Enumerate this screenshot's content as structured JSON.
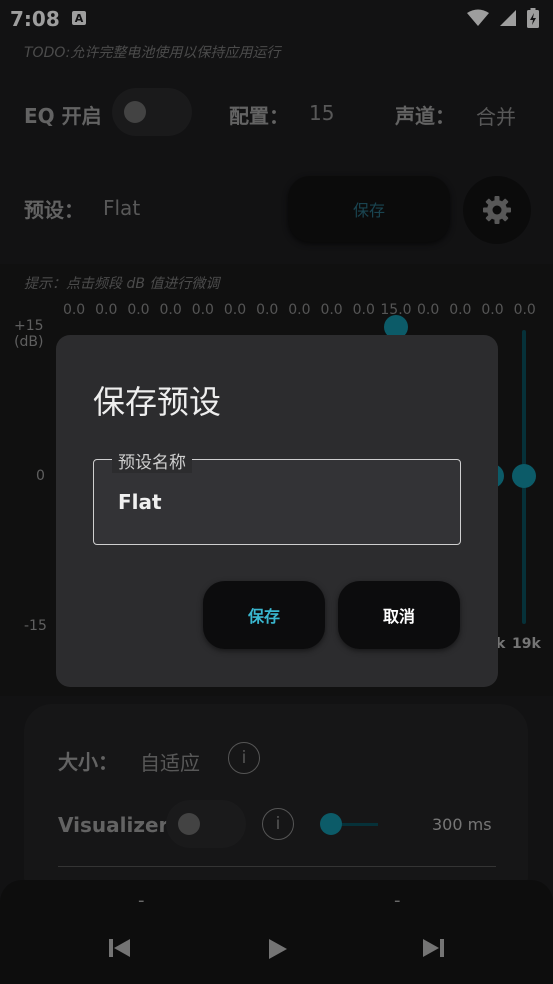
{
  "status": {
    "time": "7:08",
    "a_icon": "A"
  },
  "todo": "TODO:允许完整电池使用以保持应用运行",
  "eq": {
    "label": "EQ 开启",
    "config_label": "配置：",
    "config_value": "15",
    "channel_label": "声道：",
    "channel_value": "合并"
  },
  "preset": {
    "label": "预设：",
    "value": "Flat",
    "save_label": "保存"
  },
  "hint": "提示：点击频段 dB 值进行微调",
  "bands": {
    "values": [
      "0.0",
      "0.0",
      "0.0",
      "0.0",
      "0.0",
      "0.0",
      "0.0",
      "0.0",
      "0.0",
      "0.0",
      "15.0",
      "0.0",
      "0.0",
      "0.0",
      "0.0"
    ],
    "scale_top": "+15",
    "scale_top_unit": "(dB)",
    "scale_mid": "0",
    "scale_bottom": "-15",
    "freq_k": "k",
    "freq_19k": "19k"
  },
  "dialog": {
    "title": "保存预设",
    "field_label": "预设名称",
    "field_value": "Flat",
    "save_label": "保存",
    "cancel_label": "取消"
  },
  "card": {
    "size_label": "大小：",
    "size_value": "自适应",
    "visualizer_label": "Visualizer",
    "visualizer_ms": "300 ms",
    "info_glyph": "i"
  },
  "player": {
    "left_dash": "-",
    "right_dash": "-"
  },
  "colors": {
    "accent": "#1493a8",
    "accent_text": "#3ab8d0",
    "background": "#1d1d1f",
    "dialog": "#2c2c2e"
  }
}
